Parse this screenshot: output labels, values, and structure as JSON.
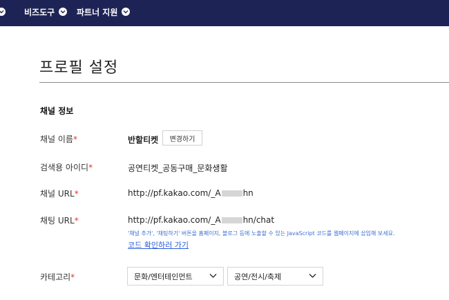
{
  "topnav": {
    "items": [
      {
        "label": ""
      },
      {
        "label": "비즈도구"
      },
      {
        "label": "파트너 지원"
      }
    ]
  },
  "page": {
    "title": "프로필 설정"
  },
  "channel_info": {
    "section_title": "채널 정보",
    "required_mark": "*",
    "name": {
      "label": "채널 이름",
      "value": "반할티켓",
      "change_button": "변경하기"
    },
    "search_id": {
      "label": "검색용 아이디",
      "value": "공연티켓_공동구매_문화생활"
    },
    "channel_url": {
      "label": "채널 URL",
      "value_prefix": "http://pf.kakao.com/_A",
      "value_suffix": "hn"
    },
    "chat_url": {
      "label": "채팅 URL",
      "value_prefix": "http://pf.kakao.com/_A",
      "value_suffix": "hn/chat",
      "note": "'채널 추가', '채팅하기' 버튼을 홈페이지, 블로그 등에 노출할 수 있는 JavaScript 코드를 웹페이지에 삽입해 보세요.",
      "link": "코드 확인하러 가기"
    },
    "category": {
      "label": "카테고리",
      "primary": "문화/엔터테인먼트",
      "secondary": "공연/전시/축제"
    }
  },
  "colors": {
    "topbar": "#1d2354",
    "required": "#e5322d",
    "link": "#2a5bd7"
  }
}
